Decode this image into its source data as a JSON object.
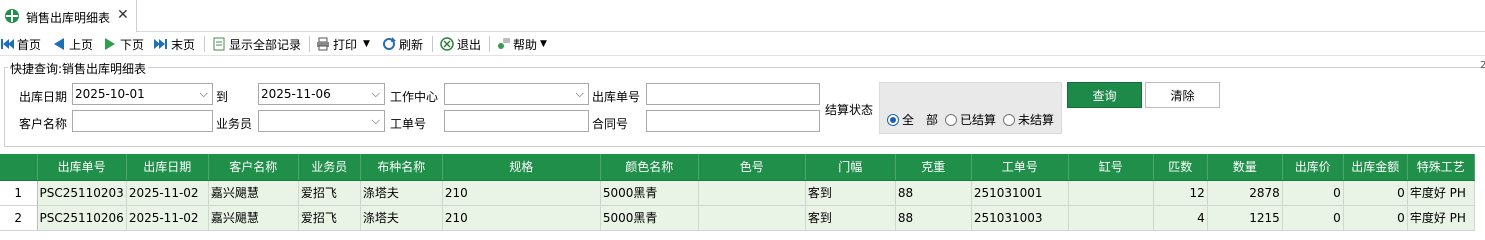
{
  "tab": {
    "title": "销售出库明细表",
    "close": "✕",
    "icon": "globe-icon"
  },
  "toolbar": {
    "first": "首页",
    "prev": "上页",
    "next": "下页",
    "last": "末页",
    "show_all": "显示全部记录",
    "print": "打印",
    "refresh": "刷新",
    "exit": "退出",
    "help": "帮助"
  },
  "query": {
    "title": "快捷查询:销售出库明细表",
    "out_date_label": "出库日期",
    "out_date_from": "2025-10-01",
    "to_label": "到",
    "out_date_to": "2025-11-06",
    "work_center_label": "工作中心",
    "work_center": "",
    "out_no_label": "出库单号",
    "out_no": "",
    "settle_label": "结算状态",
    "customer_label": "客户名称",
    "customer": "",
    "salesman_label": "业务员",
    "salesman": "",
    "work_order_label": "工单号",
    "work_order": "",
    "contract_label": "合同号",
    "contract": "",
    "radio_all": "全　部",
    "radio_settled": "已结算",
    "radio_unsettled": "未结算",
    "query_button": "查询",
    "clear_button": "清除"
  },
  "table": {
    "columns": [
      "",
      "出库单号",
      "出库日期",
      "客户名称",
      "业务员",
      "布种名称",
      "规格",
      "颜色名称",
      "色号",
      "门幅",
      "克重",
      "工单号",
      "缸号",
      "匹数",
      "数量",
      "出库价",
      "出库金额",
      "特殊工艺"
    ],
    "rows": [
      [
        "1",
        "PSC25110203",
        "2025-11-02",
        "嘉兴飓慧",
        "爱招飞",
        "涤塔夫",
        "210",
        "5000黑青",
        "",
        "客到",
        "88",
        "251031001",
        "",
        "12",
        "2878",
        "0",
        "0",
        "牢度好  PH"
      ],
      [
        "2",
        "PSC25110206",
        "2025-11-02",
        "嘉兴飓慧",
        "爱招飞",
        "涤塔夫",
        "210",
        "5000黑青",
        "",
        "客到",
        "88",
        "251031003",
        "",
        "4",
        "1215",
        "0",
        "0",
        "牢度好  PH"
      ]
    ]
  },
  "colors": {
    "accent": "#1f8f4a",
    "row_bg": "#eaf4e6"
  }
}
